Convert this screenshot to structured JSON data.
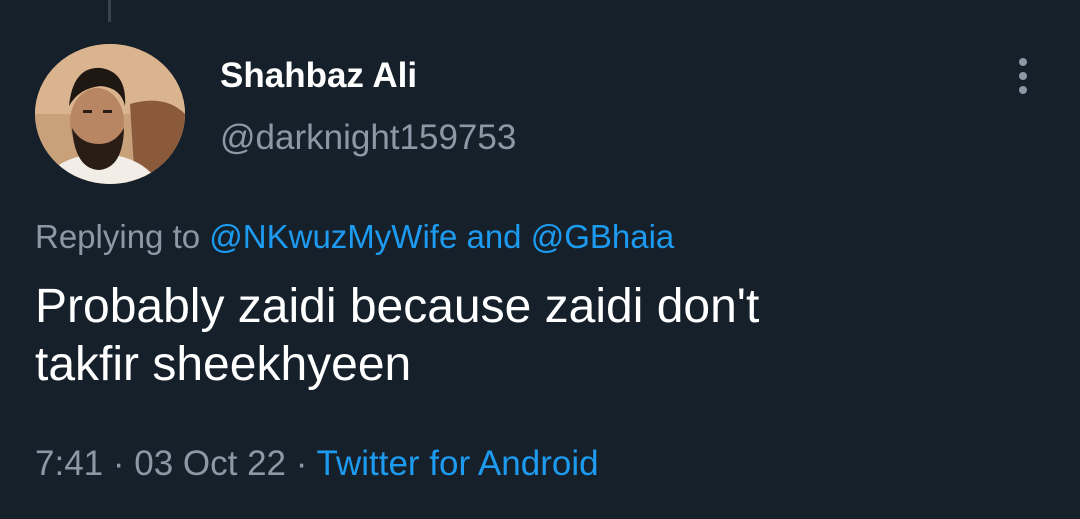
{
  "tweet": {
    "author": {
      "display_name": "Shahbaz Ali",
      "handle": "@darknight159753"
    },
    "more_icon": "more-vertical-icon",
    "reply_context": {
      "prefix": "Replying to",
      "mention_1": "@NKwuzMyWife",
      "conjunction": "and",
      "mention_2": "@GBhaia"
    },
    "text_lines": [
      "Probably zaidi because zaidi don't",
      "takfir sheekhyeen"
    ],
    "time": "7:41",
    "separator": "·",
    "date": "03 Oct 22",
    "source": "Twitter for Android"
  },
  "colors": {
    "background": "#15202b",
    "text": "#ffffff",
    "secondary_text": "#8b98a5",
    "link": "#1d9bf0"
  }
}
